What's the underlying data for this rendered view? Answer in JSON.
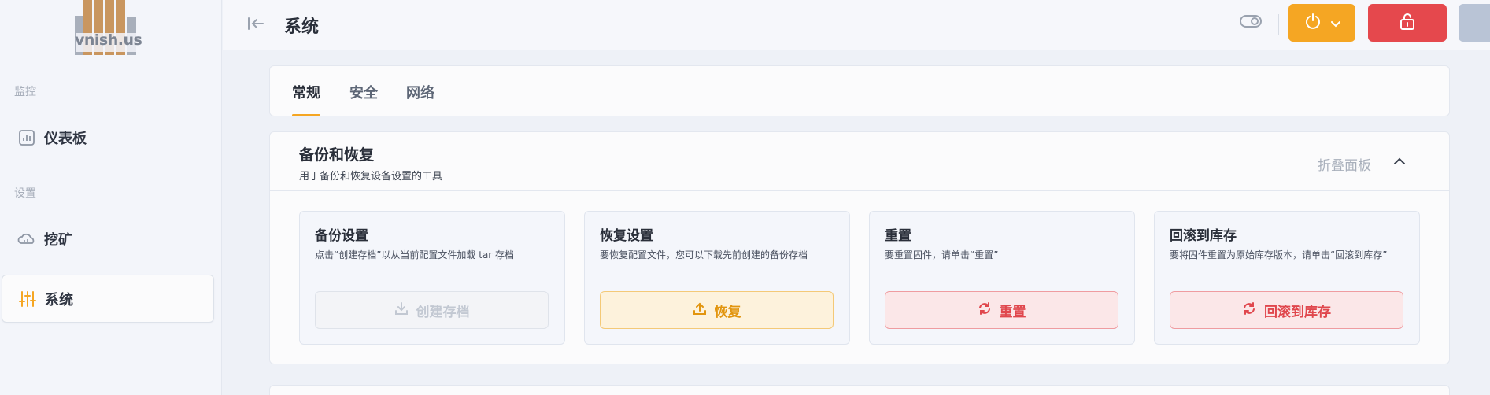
{
  "logo": {
    "text": "vnish.us"
  },
  "sidebar": {
    "sections": [
      {
        "label": "监控",
        "items": [
          {
            "label": "仪表板",
            "icon": "chart-icon"
          }
        ]
      },
      {
        "label": "设置",
        "items": [
          {
            "label": "挖矿",
            "icon": "cloud-icon"
          },
          {
            "label": "系统",
            "icon": "sliders-icon",
            "active": true
          }
        ]
      }
    ]
  },
  "header": {
    "title": "系统",
    "icons": [
      "collapse-sidebar-icon",
      "toggle-icon",
      "power-icon",
      "unlock-icon",
      "panel-icon"
    ],
    "colors": {
      "power": "#f5a623",
      "lock": "#e5484d",
      "panel": "#b9c4d6"
    }
  },
  "tabs": [
    {
      "label": "常规",
      "active": true
    },
    {
      "label": "安全"
    },
    {
      "label": "网络"
    }
  ],
  "panel": {
    "title": "备份和恢复",
    "subtitle": "用于备份和恢复设备设置的工具",
    "fold_label": "折叠面板",
    "cards": [
      {
        "title": "备份设置",
        "desc": "点击“创建存档”以从当前配置文件加载 tar 存档",
        "button": "创建存档",
        "button_icon": "download-icon",
        "state": "disabled"
      },
      {
        "title": "恢复设置",
        "desc": "要恢复配置文件，您可以下载先前创建的备份存档",
        "button": "恢复",
        "button_icon": "upload-icon",
        "state": "warning"
      },
      {
        "title": "重置",
        "desc": "要重置固件，请单击“重置”",
        "button": "重置",
        "button_icon": "refresh-icon",
        "state": "danger"
      },
      {
        "title": "回滚到库存",
        "desc": "要将固件重置为原始库存版本，请单击“回滚到库存”",
        "button": "回滚到库存",
        "button_icon": "refresh-icon",
        "state": "danger"
      }
    ]
  }
}
